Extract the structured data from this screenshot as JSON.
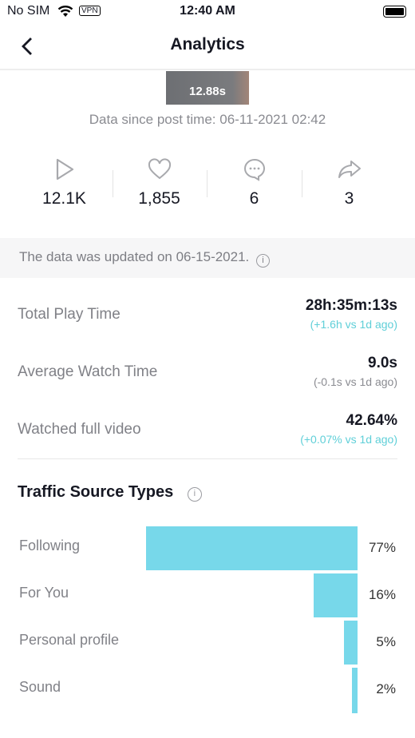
{
  "status_bar": {
    "carrier": "No SIM",
    "vpn": "VPN",
    "time": "12:40 AM"
  },
  "header": {
    "title": "Analytics"
  },
  "video": {
    "duration": "12.88s",
    "data_since": "Data since post time: 06-11-2021 02:42"
  },
  "stats": [
    {
      "icon": "play-icon",
      "value": "12.1K"
    },
    {
      "icon": "heart-icon",
      "value": "1,855"
    },
    {
      "icon": "comment-icon",
      "value": "6"
    },
    {
      "icon": "share-icon",
      "value": "3"
    }
  ],
  "updated": "The data was updated on 06-15-2021.",
  "metrics": [
    {
      "label": "Total Play Time",
      "value": "28h:35m:13s",
      "change": "(+1.6h vs 1d ago)",
      "change_color": "#5fcfd8"
    },
    {
      "label": "Average Watch Time",
      "value": "9.0s",
      "change": "(-0.1s vs 1d ago)",
      "change_color": "#8a8b91"
    },
    {
      "label": "Watched full video",
      "value": "42.64%",
      "change": "(+0.07% vs 1d ago)",
      "change_color": "#5fcfd8"
    }
  ],
  "traffic": {
    "title": "Traffic Source Types",
    "bar_color": "#77d8ea",
    "sources": [
      {
        "label": "Following",
        "value": 77,
        "pct": "77%"
      },
      {
        "label": "For You",
        "value": 16,
        "pct": "16%"
      },
      {
        "label": "Personal profile",
        "value": 5,
        "pct": "5%"
      },
      {
        "label": "Sound",
        "value": 2,
        "pct": "2%"
      }
    ]
  }
}
